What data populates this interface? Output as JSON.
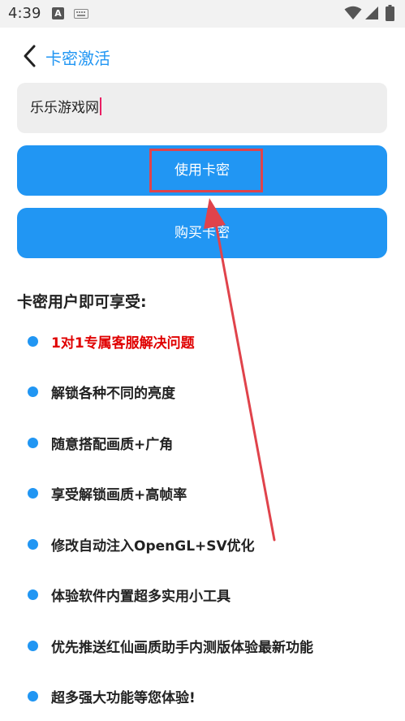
{
  "status_bar": {
    "time": "4:39",
    "notification_letter": "A",
    "icons": [
      "keyboard-icon",
      "wifi-icon",
      "signal-icon",
      "battery-icon"
    ]
  },
  "header": {
    "title": "卡密激活",
    "back_icon": "chevron-left-icon"
  },
  "code_input": {
    "value": "乐乐游戏网"
  },
  "buttons": {
    "use_label": "使用卡密",
    "buy_label": "购买卡密"
  },
  "benefits": {
    "title": "卡密用户即可享受:",
    "items": [
      "1对1专属客服解决问题",
      "解锁各种不同的亮度",
      "随意搭配画质+广角",
      "享受解锁画质+高帧率",
      "修改自动注入OpenGL+SV优化",
      "体验软件内置超多实用小工具",
      "优先推送红仙画质助手内测版体验最新功能",
      "超多强大功能等您体验!"
    ]
  },
  "colors": {
    "accent": "#2196f3",
    "highlight_red": "#e00000",
    "annotation_red": "#e0434b",
    "input_bg": "#eeeeee"
  }
}
